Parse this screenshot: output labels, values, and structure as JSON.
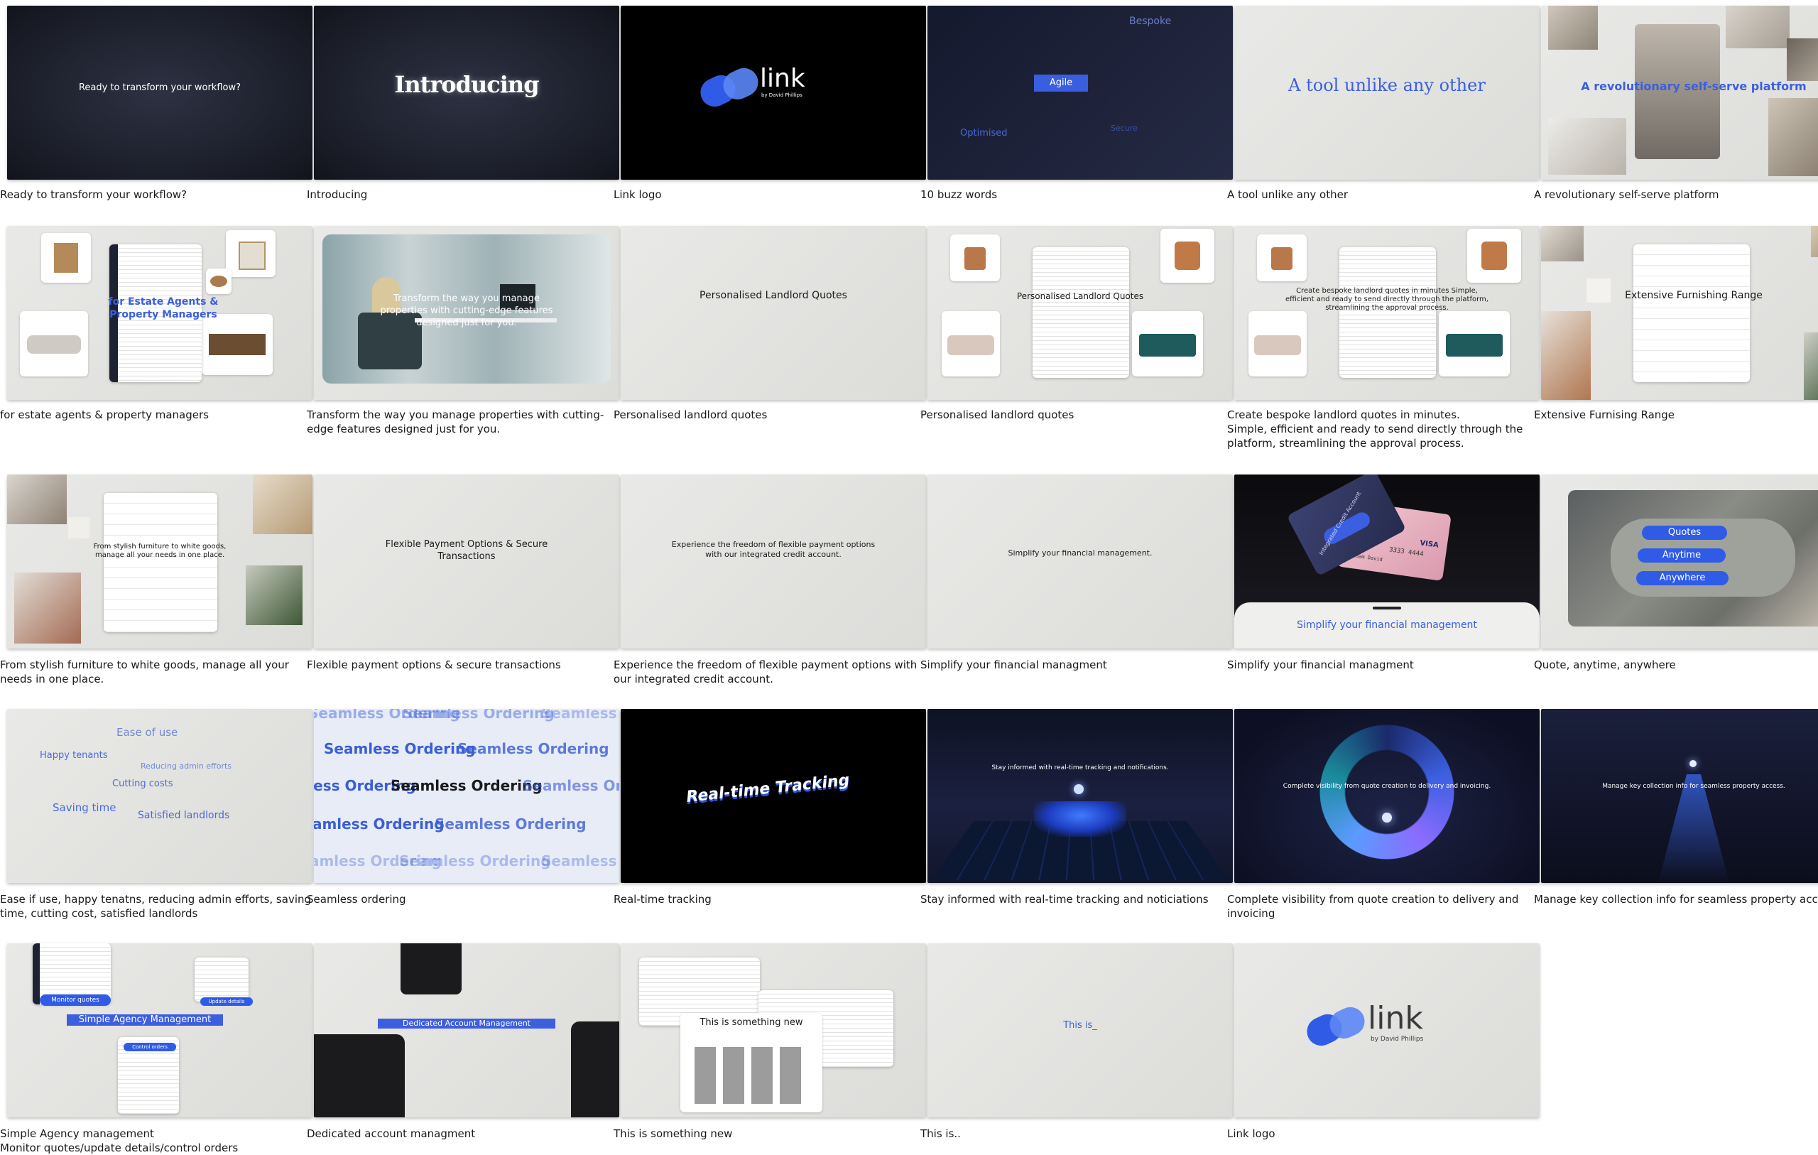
{
  "frames": [
    {
      "caption": "Ready to transform your workflow?",
      "text": "Ready to transform your workflow?"
    },
    {
      "caption": "Introducing",
      "text": "Introducing"
    },
    {
      "caption": "Link logo",
      "logo_word": "link",
      "logo_sub": "by David Phillips"
    },
    {
      "caption": "10 buzz words",
      "words": [
        "Bespoke",
        "Agile",
        "Optimised",
        "Secure"
      ]
    },
    {
      "caption": "A tool unlike any other",
      "text": "A tool unlike any other"
    },
    {
      "caption": "A revolutionary self-serve platform",
      "text": "A revolutionary self-serve platform"
    },
    {
      "caption": "for estate agents & property managers",
      "text": "for Estate Agents & Property Managers"
    },
    {
      "caption": "Transform the way you manage properties  with cutting-edge features designed just for you.",
      "text": "Transform the way you manage properties with cutting-edge features designed just for you."
    },
    {
      "caption": "Personalised landlord quotes",
      "text": "Personalised Landlord Quotes"
    },
    {
      "caption": "Personalised landlord quotes",
      "text": "Personalised Landlord Quotes"
    },
    {
      "caption": "Create bespoke landlord quotes in minutes.\nSimple, efficient and ready to send directly through the platform, streamlining the approval process.",
      "text": "Create bespoke landlord quotes in minutes Simple, efficient and ready to send directly through the platform, streamlining the approval process."
    },
    {
      "caption": "Extensive Furnising Range",
      "text": "Extensive Furnishing Range"
    },
    {
      "caption": "From stylish furniture to white goods, manage all your needs in one place.",
      "text": "From stylish furniture to white goods, manage all your needs in one place."
    },
    {
      "caption": "Flexible payment options & secure transactions",
      "text": "Flexible Payment Options & Secure Transactions"
    },
    {
      "caption": "Experience the freedom of flexible payment options with our integrated credit account.",
      "text": "Experience the freedom of flexible payment options with our integrated credit account."
    },
    {
      "caption": "Simplify your financial managment",
      "text": "Simplify your financial management."
    },
    {
      "caption": "Simplify your financial managment",
      "text": "Simplify your financial management",
      "card_label": "Integrated Credit Account",
      "card_number": "3333 4444",
      "card_name": "Mr Sam David",
      "card_brand": "VISA"
    },
    {
      "caption": "Quote, anytime, anywhere",
      "pills": [
        "Quotes",
        "Anytime",
        "Anywhere"
      ]
    },
    {
      "caption": "Ease if use, happy tenatns, reducing admin efforts, saving time, cutting cost, satisfied landlords",
      "words": [
        "Ease of use",
        "Happy tenants",
        "Reducing admin efforts",
        "Cutting costs",
        "Saving time",
        "Satisfied landlords"
      ]
    },
    {
      "caption": "Seamless ordering",
      "text": "Seamless Ordering"
    },
    {
      "caption": "Real-time tracking",
      "text": "Real-time Tracking"
    },
    {
      "caption": "Stay informed with real-time tracking and noticiations",
      "text": "Stay informed with real-time tracking and notifications."
    },
    {
      "caption": "Complete visibility from quote creation to delivery and invoicing",
      "text": "Complete visibility from quote creation to delivery and invoicing."
    },
    {
      "caption": "Manage key collection info for seamless property access",
      "text": "Manage key collection info for seamless property access."
    },
    {
      "caption": "Simple Agency management\nMonitor quotes/update details/control orders",
      "text": "Simple Agency Management",
      "tags": [
        "Monitor quotes",
        "Update details",
        "Control orders"
      ]
    },
    {
      "caption": "Dedicated account managment",
      "text": "Dedicated Account Management"
    },
    {
      "caption": "This is something new",
      "text": "This is something new"
    },
    {
      "caption": "This is..",
      "text": "This is_"
    },
    {
      "caption": "Link logo",
      "logo_word": "link",
      "logo_sub": "by David Phillips"
    }
  ],
  "colors": {
    "accent": "#3b5fe0",
    "dark": "#1b1e29",
    "light": "#e4e4e2"
  }
}
